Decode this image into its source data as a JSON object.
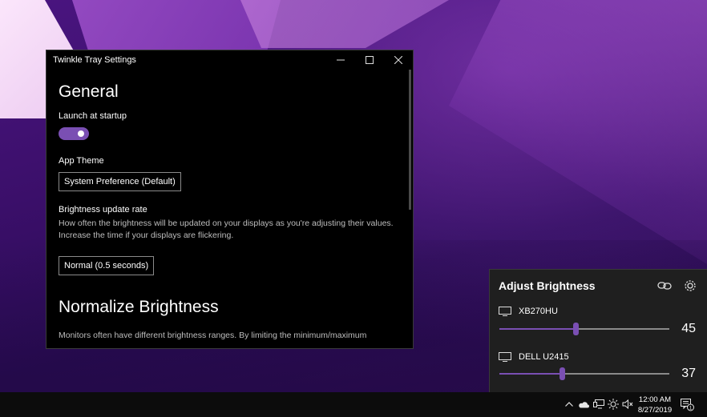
{
  "window": {
    "title": "Twinkle Tray Settings",
    "controls": {
      "minimize": "—",
      "maximize": "☐",
      "close": "✕"
    }
  },
  "general": {
    "heading": "General",
    "launch_label": "Launch at startup",
    "launch_enabled": true,
    "theme_label": "App Theme",
    "theme_value": "System Preference (Default)",
    "rate_label": "Brightness update rate",
    "rate_desc": "How often the brightness will be updated on your displays as you're adjusting their values. Increase the time if your displays are flickering.",
    "rate_value": "Normal (0.5 seconds)"
  },
  "normalize": {
    "heading": "Normalize Brightness",
    "desc": "Monitors often have different brightness ranges. By limiting the minimum/maximum"
  },
  "flyout": {
    "title": "Adjust Brightness",
    "monitors": [
      {
        "name": "XB270HU",
        "value": "45",
        "level": 0.45
      },
      {
        "name": "DELL U2415",
        "value": "37",
        "level": 0.37
      }
    ]
  },
  "taskbar": {
    "time": "12:00 AM",
    "date": "8/27/2019",
    "notification_count": "1"
  },
  "colors": {
    "accent": "#7a4fb3",
    "window_bg": "#000000",
    "flyout_bg": "#1f1f1f",
    "taskbar_bg": "#0c0c0c"
  }
}
